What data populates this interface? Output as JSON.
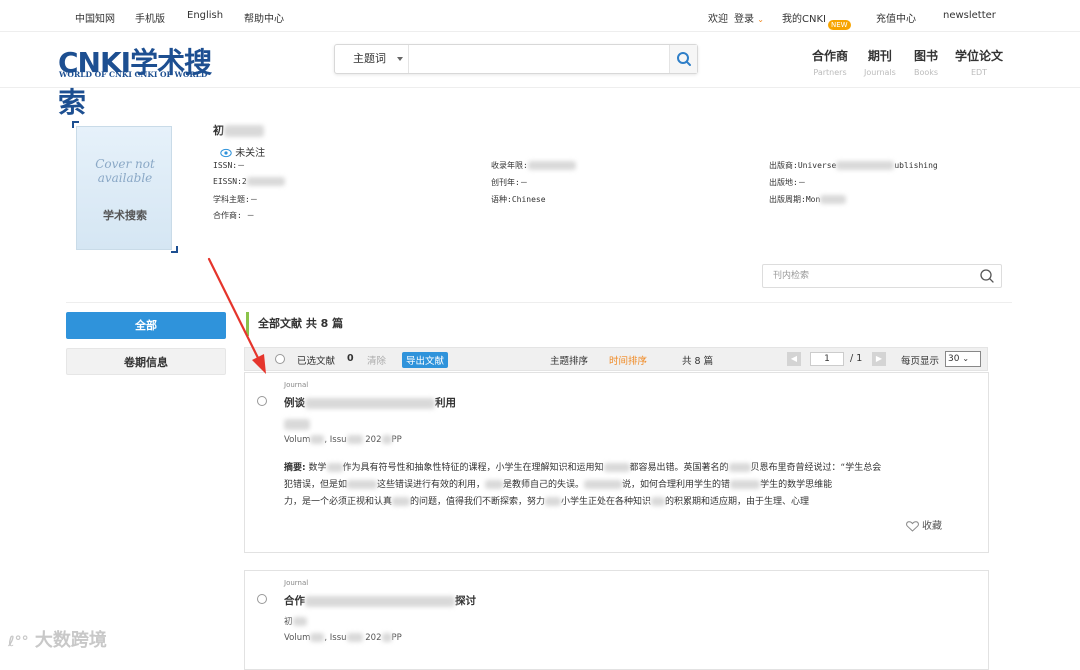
{
  "topbar": {
    "left_links": [
      "中国知网",
      "手机版",
      "English",
      "帮助中心"
    ],
    "welcome": "欢迎",
    "login": "登录",
    "my_cnki": "我的CNKI",
    "new_badge": "NEW",
    "recharge": "充值中心",
    "newsletter": "newsletter"
  },
  "logo": {
    "main": "CNKI学术搜索",
    "sub": "WORLD OF CNKI CNKI OF WORLD"
  },
  "search": {
    "field": "主题词",
    "placeholder": ""
  },
  "nav": [
    {
      "cn": "合作商",
      "en": "Partners"
    },
    {
      "cn": "期刊",
      "en": "Journals"
    },
    {
      "cn": "图书",
      "en": "Books"
    },
    {
      "cn": "学位论文",
      "en": "EDT"
    }
  ],
  "cover": {
    "text_line1": "Cover not",
    "text_line2": "available",
    "logo": "学术搜索"
  },
  "journal": {
    "name_prefix": "初",
    "follow": "未关注",
    "issn": "ISSN:－",
    "eissn": "EISSN:2",
    "subject": "学科主题:－",
    "partner": "合作商: －",
    "coverage": "收录年限:",
    "founded": "创刊年:－",
    "language": "语种:Chinese",
    "publisher": "出版商:Universe",
    "publisher_tail": "ublishing",
    "place": "出版地:－",
    "frequency": "出版周期:Mon"
  },
  "search_in": {
    "placeholder": "刊内检索"
  },
  "sidebar": {
    "all": "全部",
    "volume": "卷期信息"
  },
  "list": {
    "total_title": "全部文献 共 8 篇",
    "selected": "已选文献",
    "selected_count": "0",
    "clear": "清除",
    "export": "导出文献",
    "sort_topic": "主题排序",
    "sort_time": "时间排序",
    "count": "共 8 篇",
    "page_current": "1",
    "page_total": "/ 1",
    "per_page_label": "每页显示",
    "per_page_value": "30"
  },
  "articles": [
    {
      "type": "Journal",
      "title_start": "例谈",
      "title_end": "利用",
      "meta_vol": "Volum",
      "meta_issue": "Issu",
      "meta_year": "202",
      "meta_pp": "PP",
      "abstract_label": "摘要:",
      "abstract_l1": "数学",
      "abstract_l1b": "作为具有符号性和抽象性特征的课程，小学生在理解知识和运用知",
      "abstract_l1c": "都容易出错。英国著名的",
      "abstract_l1d": "贝恩布里奇曾经说过：“学生总会",
      "abstract_l2": "犯错误，但是如",
      "abstract_l2b": "这些错误进行有效的利用，",
      "abstract_l2c": "是教师自己的失误。",
      "abstract_l2d": "说，如何合理利用学生的错",
      "abstract_l2e": "学生的数学思维能",
      "abstract_l3": "力，是一个必须正视和认真",
      "abstract_l3b": "的问题，值得我们不断探索，努力",
      "abstract_l3c": "小学生正处在各种知识",
      "abstract_l3d": "的积累期和适应期，由于生理、心理",
      "favorite": "收藏"
    },
    {
      "type": "Journal",
      "title_start": "合作",
      "title_end": "探讨",
      "author": "初",
      "meta_vol": "Volum",
      "meta_issue": "Issu",
      "meta_year": "202",
      "meta_pp": "PP"
    }
  ],
  "watermark": "大数跨境",
  "colors": {
    "brand_blue": "#1d4f91",
    "accent_blue": "#2f93db",
    "sort_active": "#f08a24",
    "arrow_red": "#e5352c",
    "new_badge": "#f7a400"
  }
}
